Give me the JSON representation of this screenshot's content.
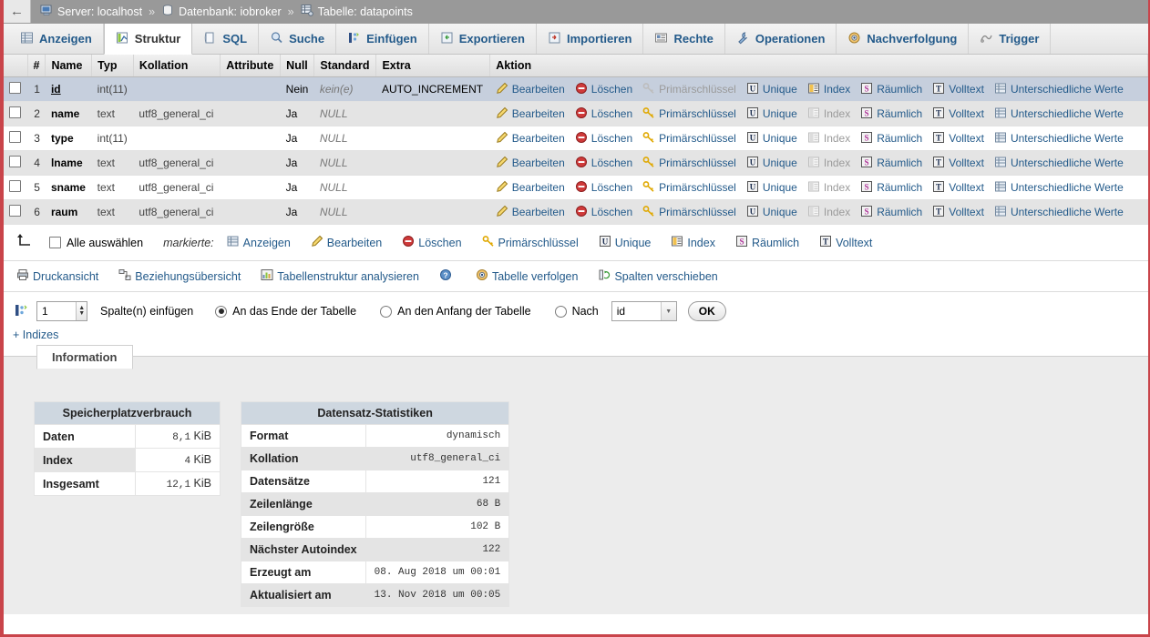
{
  "breadcrumb": {
    "back_label": "←",
    "server_label": "Server: localhost",
    "db_label": "Datenbank: iobroker",
    "table_label": "Tabelle: datapoints",
    "separator": "»"
  },
  "tabs": [
    {
      "label": "Anzeigen",
      "icon": "browse-icon",
      "active": false
    },
    {
      "label": "Struktur",
      "icon": "structure-icon",
      "active": true
    },
    {
      "label": "SQL",
      "icon": "sql-icon",
      "active": false
    },
    {
      "label": "Suche",
      "icon": "search-icon",
      "active": false
    },
    {
      "label": "Einfügen",
      "icon": "insert-icon",
      "active": false
    },
    {
      "label": "Exportieren",
      "icon": "export-icon",
      "active": false
    },
    {
      "label": "Importieren",
      "icon": "import-icon",
      "active": false
    },
    {
      "label": "Rechte",
      "icon": "privileges-icon",
      "active": false
    },
    {
      "label": "Operationen",
      "icon": "operations-icon",
      "active": false
    },
    {
      "label": "Nachverfolgung",
      "icon": "tracking-icon",
      "active": false
    },
    {
      "label": "Trigger",
      "icon": "trigger-icon",
      "active": false
    }
  ],
  "structure": {
    "headers": [
      "#",
      "Name",
      "Typ",
      "Kollation",
      "Attribute",
      "Null",
      "Standard",
      "Extra",
      "Aktion"
    ],
    "action_labels": {
      "edit": "Bearbeiten",
      "drop": "Löschen",
      "primary": "Primärschlüssel",
      "unique": "Unique",
      "index": "Index",
      "spatial": "Räumlich",
      "fulltext": "Volltext",
      "distinct": "Unterschiedliche Werte"
    },
    "rows": [
      {
        "num": "1",
        "name": "id",
        "is_pk": true,
        "type": "int(11)",
        "collation": "",
        "attributes": "",
        "null": "Nein",
        "default": "kein(e)",
        "extra": "AUTO_INCREMENT"
      },
      {
        "num": "2",
        "name": "name",
        "is_pk": false,
        "type": "text",
        "collation": "utf8_general_ci",
        "attributes": "",
        "null": "Ja",
        "default": "NULL",
        "extra": ""
      },
      {
        "num": "3",
        "name": "type",
        "is_pk": false,
        "type": "int(11)",
        "collation": "",
        "attributes": "",
        "null": "Ja",
        "default": "NULL",
        "extra": ""
      },
      {
        "num": "4",
        "name": "lname",
        "is_pk": false,
        "type": "text",
        "collation": "utf8_general_ci",
        "attributes": "",
        "null": "Ja",
        "default": "NULL",
        "extra": ""
      },
      {
        "num": "5",
        "name": "sname",
        "is_pk": false,
        "type": "text",
        "collation": "utf8_general_ci",
        "attributes": "",
        "null": "Ja",
        "default": "NULL",
        "extra": ""
      },
      {
        "num": "6",
        "name": "raum",
        "is_pk": false,
        "type": "text",
        "collation": "utf8_general_ci",
        "attributes": "",
        "null": "Ja",
        "default": "NULL",
        "extra": ""
      }
    ]
  },
  "bulk_toolbar": {
    "select_all_label": "Alle auswählen",
    "marked_label": "markierte:",
    "items": [
      {
        "label": "Anzeigen",
        "icon": "browse-icon"
      },
      {
        "label": "Bearbeiten",
        "icon": "pencil-icon"
      },
      {
        "label": "Löschen",
        "icon": "drop-icon"
      },
      {
        "label": "Primärschlüssel",
        "icon": "key-icon"
      },
      {
        "label": "Unique",
        "icon": "unique-icon"
      },
      {
        "label": "Index",
        "icon": "index-icon"
      },
      {
        "label": "Räumlich",
        "icon": "spatial-icon"
      },
      {
        "label": "Volltext",
        "icon": "fulltext-icon"
      }
    ]
  },
  "secondary_links": [
    {
      "label": "Druckansicht",
      "icon": "print-icon"
    },
    {
      "label": "Beziehungsübersicht",
      "icon": "relation-icon"
    },
    {
      "label": "Tabellenstruktur analysieren",
      "icon": "analyze-icon"
    },
    {
      "label": "",
      "icon": "help-icon"
    },
    {
      "label": "Tabelle verfolgen",
      "icon": "tracking-icon"
    },
    {
      "label": "Spalten verschieben",
      "icon": "move-columns-icon"
    }
  ],
  "add_column_form": {
    "count_value": "1",
    "label": "Spalte(n) einfügen",
    "option_end": "An das Ende der Tabelle",
    "option_begin": "An den Anfang der Tabelle",
    "option_after": "Nach",
    "selected_option": "end",
    "after_select_value": "id",
    "ok_label": "OK",
    "indices_link": "+ Indizes"
  },
  "information": {
    "tab_label": "Information",
    "storage": {
      "caption": "Speicherplatzverbrauch",
      "rows": [
        {
          "key": "Daten",
          "num": "8,1",
          "unit": "KiB"
        },
        {
          "key": "Index",
          "num": "4",
          "unit": "KiB"
        },
        {
          "key": "Insgesamt",
          "num": "12,1",
          "unit": "KiB"
        }
      ]
    },
    "statistics": {
      "caption": "Datensatz-Statistiken",
      "rows": [
        {
          "key": "Format",
          "value": "dynamisch"
        },
        {
          "key": "Kollation",
          "value": "utf8_general_ci"
        },
        {
          "key": "Datensätze",
          "value": "121"
        },
        {
          "key": "Zeilenlänge",
          "value": "68 B"
        },
        {
          "key": "Zeilengröße",
          "value": "102 B"
        },
        {
          "key": "Nächster Autoindex",
          "value": "122"
        },
        {
          "key": "Erzeugt am",
          "value": "08. Aug 2018 um 00:01"
        },
        {
          "key": "Aktualisiert am",
          "value": "13. Nov 2018 um 00:05"
        }
      ]
    }
  },
  "colors": {
    "accent_border": "#c9444a",
    "link": "#235a8a",
    "highlight_row": "#c6cfdd",
    "caption_bg": "#ced7e0"
  }
}
